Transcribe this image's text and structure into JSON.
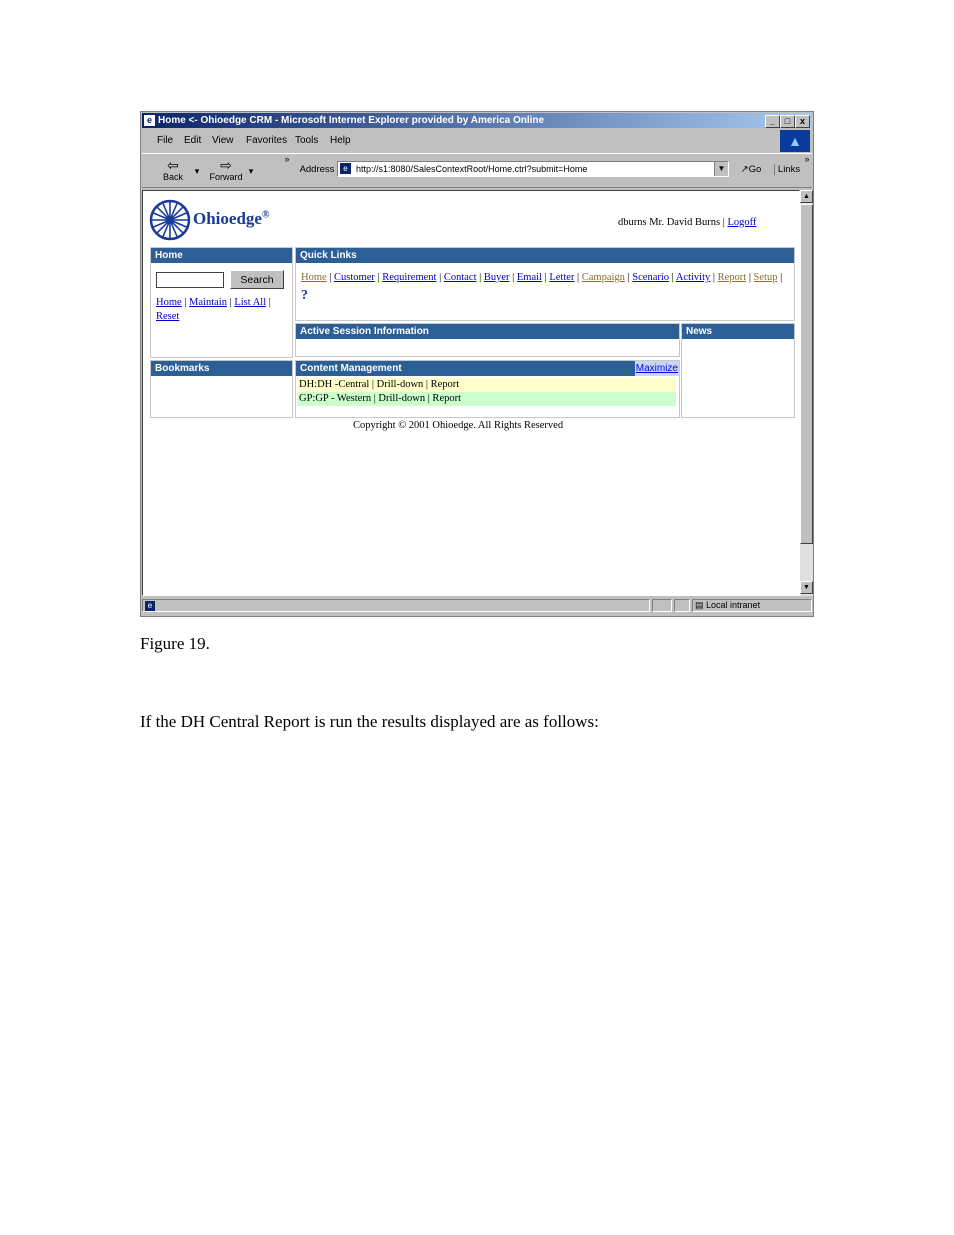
{
  "window": {
    "title": "Home <- Ohioedge CRM - Microsoft Internet Explorer provided by America Online",
    "min_label": "_",
    "max_label": "□",
    "close_label": "x"
  },
  "menu": [
    "File",
    "Edit",
    "View",
    "Favorites",
    "Tools",
    "Help"
  ],
  "toolbar": {
    "back_label": "Back",
    "forward_label": "Forward",
    "address_label": "Address",
    "url": "http://s1:8080/SalesContextRoot/Home.ctrl?submit=Home",
    "go_label": "Go",
    "links_label": "Links"
  },
  "header": {
    "logo_text": "Ohioedge",
    "logo_reg": "®",
    "user_text": "dburns Mr. David Burns |",
    "logoff_label": "Logoff"
  },
  "home_panel": {
    "title": "Home",
    "search_value": "",
    "search_button": "Search",
    "links": [
      "Home",
      "Maintain",
      "List All",
      "Reset"
    ]
  },
  "quick_links": {
    "title": "Quick Links",
    "links": [
      "Home",
      "Customer",
      "Requirement",
      "Contact",
      "Buyer",
      "Email",
      "Letter",
      "Campaign",
      "Scenario",
      "Activity",
      "Report",
      "Setup"
    ],
    "help_label": "?"
  },
  "session": {
    "title": "Active Session Information"
  },
  "news": {
    "title": "News"
  },
  "bookmarks": {
    "title": "Bookmarks"
  },
  "content_mgmt": {
    "title": "Content Management",
    "maximize_label": "Maximize",
    "rows": [
      {
        "text": "DH:DH -Central | Drill-down | Report",
        "color": "#ffffcc"
      },
      {
        "text": "GP:GP - Western | Drill-down | Report",
        "color": "#ccffcc"
      }
    ]
  },
  "copyright": "Copyright © 2001 Ohioedge. All Rights Reserved",
  "statusbar": {
    "zone_label": "Local intranet"
  },
  "document": {
    "caption": "Figure 19.",
    "paragraph": "If the DH Central Report is run the results displayed are as follows:"
  },
  "colors": {
    "header_blue": "#2c5f96",
    "title_blue": "#0a246a",
    "link_blue": "#0000cc",
    "visited": "#8b6d2e"
  }
}
